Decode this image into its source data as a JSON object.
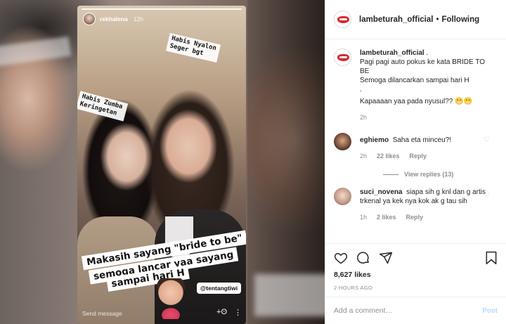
{
  "story": {
    "username": "rekhalena",
    "time": "12h",
    "sticker_right": "Habis Nyalon\nSeger bgt",
    "sticker_left": "Habis Zumba\nKeringetan",
    "caption_lines": [
      "Makasih sayang \"bride to be\"",
      "semoga lancar yaa sayang",
      "sampai hari H"
    ],
    "tag": "@tentangtiwi",
    "send_message": "Send message"
  },
  "header": {
    "username": "lambeturah_official",
    "separator": "•",
    "follow_state": "Following"
  },
  "caption": {
    "username": "lambeturah_official",
    "suffix": " .",
    "lines": [
      "Pagi pagi auto pokus ke kata BRIDE TO BE",
      "Semoga dilancarkan sampai hari H",
      ".",
      "Kapaaaan yaa pada nyusul?? 😬😬"
    ],
    "time": "2h"
  },
  "comments": [
    {
      "username": "eghiemo",
      "text": "Saha eta minceu?!",
      "time": "2h",
      "likes": "22 likes",
      "reply": "Reply",
      "view_replies": "View replies (13)"
    },
    {
      "username": "suci_novena",
      "text": "siapa sih g knl dan g artis trkenal ya kek nya kok ak g tau sih",
      "time": "1h",
      "likes": "2 likes",
      "reply": "Reply"
    }
  ],
  "post": {
    "likes": "8,627 likes",
    "ago": "2 HOURS AGO"
  },
  "add_comment": {
    "placeholder": "Add a comment…",
    "post_label": "Post"
  },
  "icons": {
    "like": "heart-icon",
    "comment": "comment-icon",
    "share": "share-icon",
    "save": "bookmark-icon"
  }
}
